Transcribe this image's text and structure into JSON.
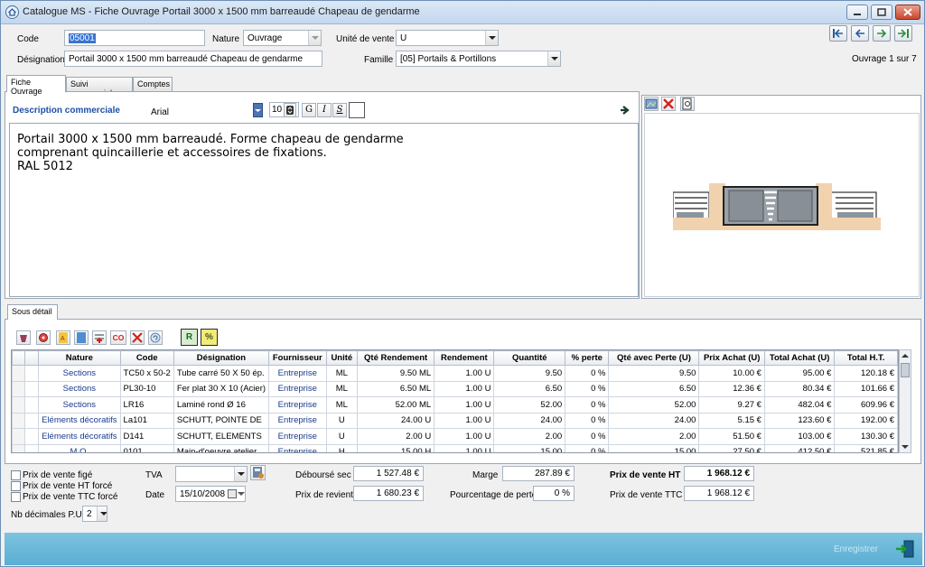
{
  "window": {
    "title": "Catalogue MS - Fiche Ouvrage Portail 3000 x 1500 mm barreaudé Chapeau de gendarme"
  },
  "header": {
    "code_label": "Code",
    "code_value": "05001",
    "nature_label": "Nature",
    "nature_value": "Ouvrage",
    "unite_label": "Unité de vente",
    "unite_value": "U",
    "designation_label": "Désignation",
    "designation_value": "Portail 3000 x 1500 mm barreaudé Chapeau de gendarme",
    "famille_label": "Famille",
    "famille_value": "[05] Portails & Portillons",
    "record_position": "Ouvrage 1 sur 7"
  },
  "tabs": [
    "Fiche Ouvrage",
    "Suivi commercial",
    "Comptes"
  ],
  "description": {
    "label": "Description commerciale",
    "font_name": "Arial",
    "font_size": "10",
    "bold_label": "G",
    "italic_label": "I",
    "underline_label": "S",
    "lines": [
      "Portail 3000 x 1500 mm barreaudé. Forme chapeau de gendarme",
      "comprenant quincaillerie et accessoires de fixations.",
      "RAL 5012"
    ]
  },
  "sub_tab": "Sous détail",
  "grid": {
    "columns": [
      "Nature",
      "Code",
      "Désignation",
      "Fournisseur",
      "Unité",
      "Qté Rendement",
      "Rendement",
      "Quantité",
      "% perte",
      "Qté avec Perte (U)",
      "Prix Achat (U)",
      "Total Achat (U)",
      "Total H.T."
    ],
    "rows": [
      [
        "Sections",
        "TC50 x 50-2",
        "Tube carré 50 X 50 ép.",
        "Entreprise",
        "ML",
        "9.50 ML",
        "1.00 U",
        "9.50",
        "0 %",
        "9.50",
        "10.00 €",
        "95.00 €",
        "120.18 €"
      ],
      [
        "Sections",
        "PL30-10",
        "Fer plat 30 X 10 (Acier)",
        "Entreprise",
        "ML",
        "6.50 ML",
        "1.00 U",
        "6.50",
        "0 %",
        "6.50",
        "12.36 €",
        "80.34 €",
        "101.66 €"
      ],
      [
        "Sections",
        "LR16",
        "Laminé rond Ø 16",
        "Entreprise",
        "ML",
        "52.00 ML",
        "1.00 U",
        "52.00",
        "0 %",
        "52.00",
        "9.27 €",
        "482.04 €",
        "609.96 €"
      ],
      [
        "Eléments décoratifs",
        "La101",
        "SCHUTT, POINTE DE",
        "Entreprise",
        "U",
        "24.00 U",
        "1.00 U",
        "24.00",
        "0 %",
        "24.00",
        "5.15 €",
        "123.60 €",
        "192.00 €"
      ],
      [
        "Eléments décoratifs",
        "D141",
        "SCHUTT, ELEMENTS",
        "Entreprise",
        "U",
        "2.00 U",
        "1.00 U",
        "2.00",
        "0 %",
        "2.00",
        "51.50 €",
        "103.00 €",
        "130.30 €"
      ],
      [
        "M.O.",
        "0101",
        "Main-d'oeuvre atelier",
        "Entreprise",
        "H",
        "15.00 H",
        "1.00 U",
        "15.00",
        "0 %",
        "15.00",
        "27.50 €",
        "412.50 €",
        "521.85 €"
      ]
    ]
  },
  "totals": {
    "prix_vente_fige": "Prix de vente figé",
    "prix_vente_ht_force": "Prix de vente HT forcé",
    "prix_vente_ttc_force": "Prix de vente TTC forcé",
    "nb_decimales_label": "Nb décimales P.U.",
    "nb_decimales_value": "2",
    "tva_label": "TVA",
    "tva_value": "",
    "date_label": "Date",
    "date_value": "15/10/2008",
    "debourse_label": "Déboursé sec",
    "debourse_value": "1 527.48 €",
    "prix_revient_label": "Prix de revient",
    "prix_revient_value": "1 680.23 €",
    "marge_label": "Marge",
    "marge_value": "287.89 €",
    "perte_label": "Pourcentage de perte",
    "perte_value": "0 %",
    "pv_ht_label": "Prix de vente HT",
    "pv_ht_value": "1 968.12 €",
    "pv_ttc_label": "Prix de vente TTC",
    "pv_ttc_value": "1 968.12 €"
  },
  "footer": {
    "save_label": "Enregistrer"
  },
  "colors": {
    "footer_bar": "#5aaed3",
    "description_label": "#1f4fa8",
    "selection": "#3874d1"
  }
}
